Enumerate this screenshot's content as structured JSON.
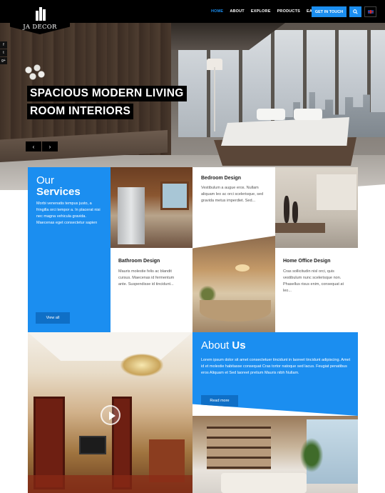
{
  "header": {
    "logo_text": "JA DECOR",
    "nav": [
      {
        "label": "HOME",
        "active": true
      },
      {
        "label": "ABOUT",
        "active": false
      },
      {
        "label": "EXPLORE",
        "active": false
      },
      {
        "label": "PRODUCTS",
        "active": false
      },
      {
        "label": "EASYBLOG",
        "active": false
      }
    ],
    "cta_label": "GET IN TOUCH",
    "accent_color": "#1b8ef0"
  },
  "hero": {
    "title_line1": "SPACIOUS MODERN LIVING",
    "title_line2": "ROOM INTERIORS",
    "prev_icon": "‹",
    "next_icon": "›",
    "social": [
      {
        "icon": "facebook-icon",
        "glyph": "f"
      },
      {
        "icon": "twitter-icon",
        "glyph": "t"
      },
      {
        "icon": "google-plus-icon",
        "glyph": "g+"
      }
    ]
  },
  "services": {
    "title_light": "Our",
    "title_bold": "Services",
    "text": "Morbi venenatis tempus justo, a fringilla orci tempor a. In placerat nisi nec magna vehicula gravida. Maecenas eget consectetur sapien",
    "view_all_label": "View all",
    "items": [
      {
        "title": "Bedroom Design",
        "desc": "Vestibulum a augue eros. Nullam aliquam leo ac orci scelerisque, sed gravida metus imperdiet. Sed..."
      },
      {
        "title": "Bathroom Design",
        "desc": "Mauris molestie felis ac blandit cursus. Maecenas id fermentum ante. Suspendisse id tincidunt..."
      },
      {
        "title": "Home Office Design",
        "desc": "Cras sollicitudin nisl orci, quis vestibulum nunc scelerisque non. Phasellus risus enim, consequat at leo..."
      }
    ]
  },
  "about": {
    "title_light": "About",
    "title_bold": "Us",
    "text": "Lorem ipsum dolor sit amet consectetuer tincidunt in laoreet tincidunt adipiscing. Amet id et molestie habitasse consequat Cras tortor natoque sed lacus. Feugiat penatibus eros Aliquam et Sed laoreet pretium Mauris nibh Nullam.",
    "read_more_label": "Read more"
  }
}
